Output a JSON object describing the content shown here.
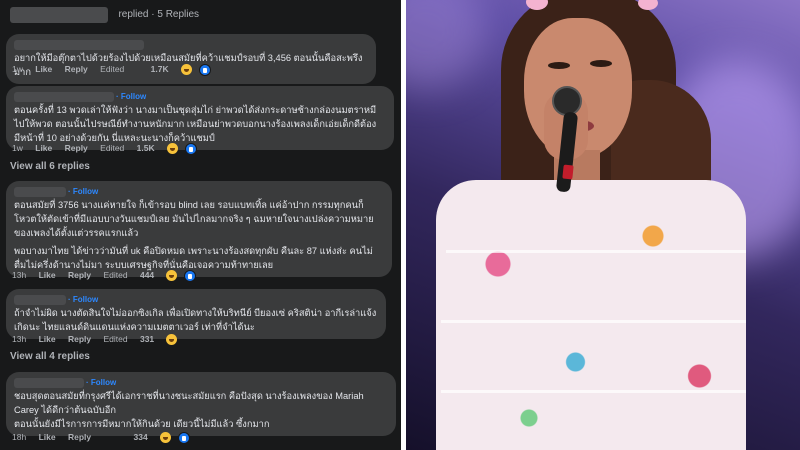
{
  "top": {
    "replies": "replied · 5 Replies"
  },
  "comments": [
    {
      "text": "อยากให้มีอตุ๊กตาไปด้วยร้องไปด้วยเหมือนสมัยที่คว้าแชมป์รอบที่ 3,456 ตอนนั้นคือสะพรึงมาก",
      "time": "1w",
      "like": "Like",
      "reply": "Reply",
      "edited": "Edited",
      "count": "1.7K"
    },
    {
      "follow": "· Follow",
      "text": "ตอนครั้งที่ 13 พวดเล่าให้ฟังว่า นางมาเป็นชุดสุ่มไก่ ย่าพวดได้ส่งกระดาษช้างกล่องนมตราหมีไปให้พวด ตอนนั้นไปรษณีย์ทำงานหนักมาก เหมือนย่าพวดบอกนางร้องเพลงเด็กเอ่ยเด็กดีต้องมีหน้าที่ 10 อย่างด้วยกัน นี่แหละนะนางก็คว้าแชมป์",
      "time": "1w",
      "like": "Like",
      "reply": "Reply",
      "edited": "Edited",
      "count": "1.5K"
    },
    {
      "follow": "· Follow",
      "text": "ตอนสมัยที่ 3756 นางแค่หายใจ ก็เข้ารอบ blind เลย รอบแบทเทิ้ล แค่อ้าปาก กรรมทุกคนก็โหวตให้ตัดเข้าที่มีแอบบางวันแชมป์เลย มันไปไกลมากจริง ๆ ฉมหายใจนางเปล่งความหมายของเพลงได้ตั้งแต่วรรคแรกแล้ว",
      "text2": "พอบางมาไทย ได้ข่าวว่ามันที่ uk คือปิดหมด เพราะนางร้องสดทุกผับ คืนละ 87 แห่งส่ะ คนไม่ตื่มไม่ครึ่งด้านางไม่มา ระบบเศรษฐกิจที่นั่นคือเจอความท้าทายเลย",
      "time": "13h",
      "like": "Like",
      "reply": "Reply",
      "edited": "Edited",
      "count": "444"
    },
    {
      "follow": "· Follow",
      "text": "ถ้าจำไม่ผิด นางตัดสินใจไม่ออกซิงเกิล เพื่อเปิดทางให้บริทนีย์ บียองเซ่ คริสติน่า อากีเรล่าแจ้งเกิดนะ ไทยแลนด์ดินแดนแห่งความเมตตาเวอร์ เท่าที่จำได้นะ",
      "time": "13h",
      "like": "Like",
      "reply": "Reply",
      "edited": "Edited",
      "count": "331"
    },
    {
      "follow": "· Follow",
      "text": "ชอบสุดตอนสมัยที่กรุงศรีได้เอกราชที่นางชนะสมัยแรก คือปังสุด นางร้องเพลงของ Mariah Carey ได้ดีกว่าต้นฉบับอีก",
      "text2": "ตอนนั้นยังมีไรการการมีหมากให้กินด้วย เดียวนี้ไม่มีแล้ว ซึ้งกมาก",
      "time": "18h",
      "like": "Like",
      "reply": "Reply",
      "edited": "",
      "count": "334"
    }
  ],
  "view_all_1": "View all 6 replies",
  "view_all_2": "View all 4 replies",
  "icons": {
    "reaction_haha": "haha-emoji-icon",
    "reaction_like": "like-icon"
  },
  "colors": {
    "panel_bg": "#18191a",
    "bubble_bg": "#3a3b3c",
    "follow": "#2d88ff",
    "stage": "#5f4fa6"
  }
}
